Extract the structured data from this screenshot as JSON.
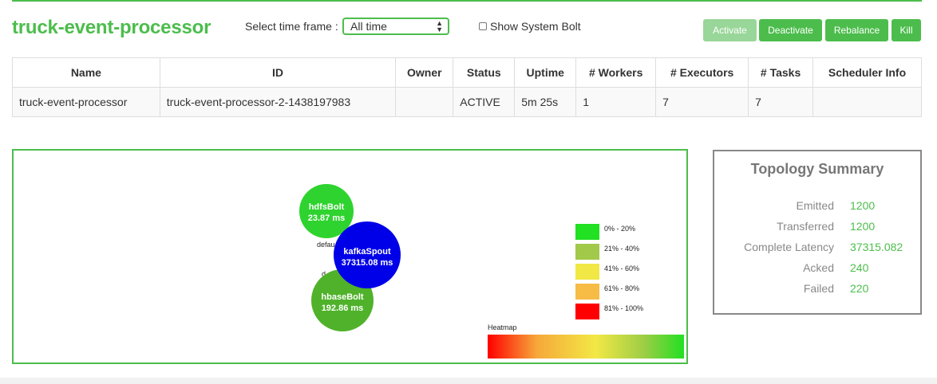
{
  "page": {
    "title": "truck-event-processor"
  },
  "timeframe": {
    "label": "Select time frame :",
    "selected": "All time"
  },
  "system_bolt": {
    "label": "Show System Bolt",
    "checked": false
  },
  "buttons": {
    "activate": "Activate",
    "deactivate": "Deactivate",
    "rebalance": "Rebalance",
    "kill": "Kill"
  },
  "table": {
    "headers": [
      "Name",
      "ID",
      "Owner",
      "Status",
      "Uptime",
      "# Workers",
      "# Executors",
      "# Tasks",
      "Scheduler Info"
    ],
    "row": [
      "truck-event-processor",
      "truck-event-processor-2-1438197983",
      "",
      "ACTIVE",
      "5m 25s",
      "1",
      "7",
      "7",
      ""
    ]
  },
  "graph": {
    "nodes": [
      {
        "name": "hdfsBolt",
        "latency": "23.87 ms",
        "color": "#2fd32f"
      },
      {
        "name": "hbaseBolt",
        "latency": "192.86 ms",
        "color": "#4fb22a"
      },
      {
        "name": "kafkaSpout",
        "latency": "37315.08 ms",
        "color": "#0000e8"
      }
    ],
    "edge_labels": [
      "defau",
      "d"
    ],
    "legend": [
      {
        "label": "0% - 20%",
        "color": "#22e022"
      },
      {
        "label": "21% - 40%",
        "color": "#a2c94a"
      },
      {
        "label": "41% - 60%",
        "color": "#f2e845"
      },
      {
        "label": "61% - 80%",
        "color": "#f6bc46"
      },
      {
        "label": "81% - 100%",
        "color": "#ff0000"
      }
    ],
    "heatmap_label": "Heatmap"
  },
  "summary": {
    "title": "Topology Summary",
    "rows": [
      {
        "label": "Emitted",
        "value": "1200"
      },
      {
        "label": "Transferred",
        "value": "1200"
      },
      {
        "label": "Complete Latency",
        "value": "37315.082"
      },
      {
        "label": "Acked",
        "value": "240"
      },
      {
        "label": "Failed",
        "value": "220"
      }
    ]
  },
  "colors": {
    "accent": "#4cbd4c",
    "accent_disabled": "#99d699",
    "summary_border": "#888888"
  }
}
